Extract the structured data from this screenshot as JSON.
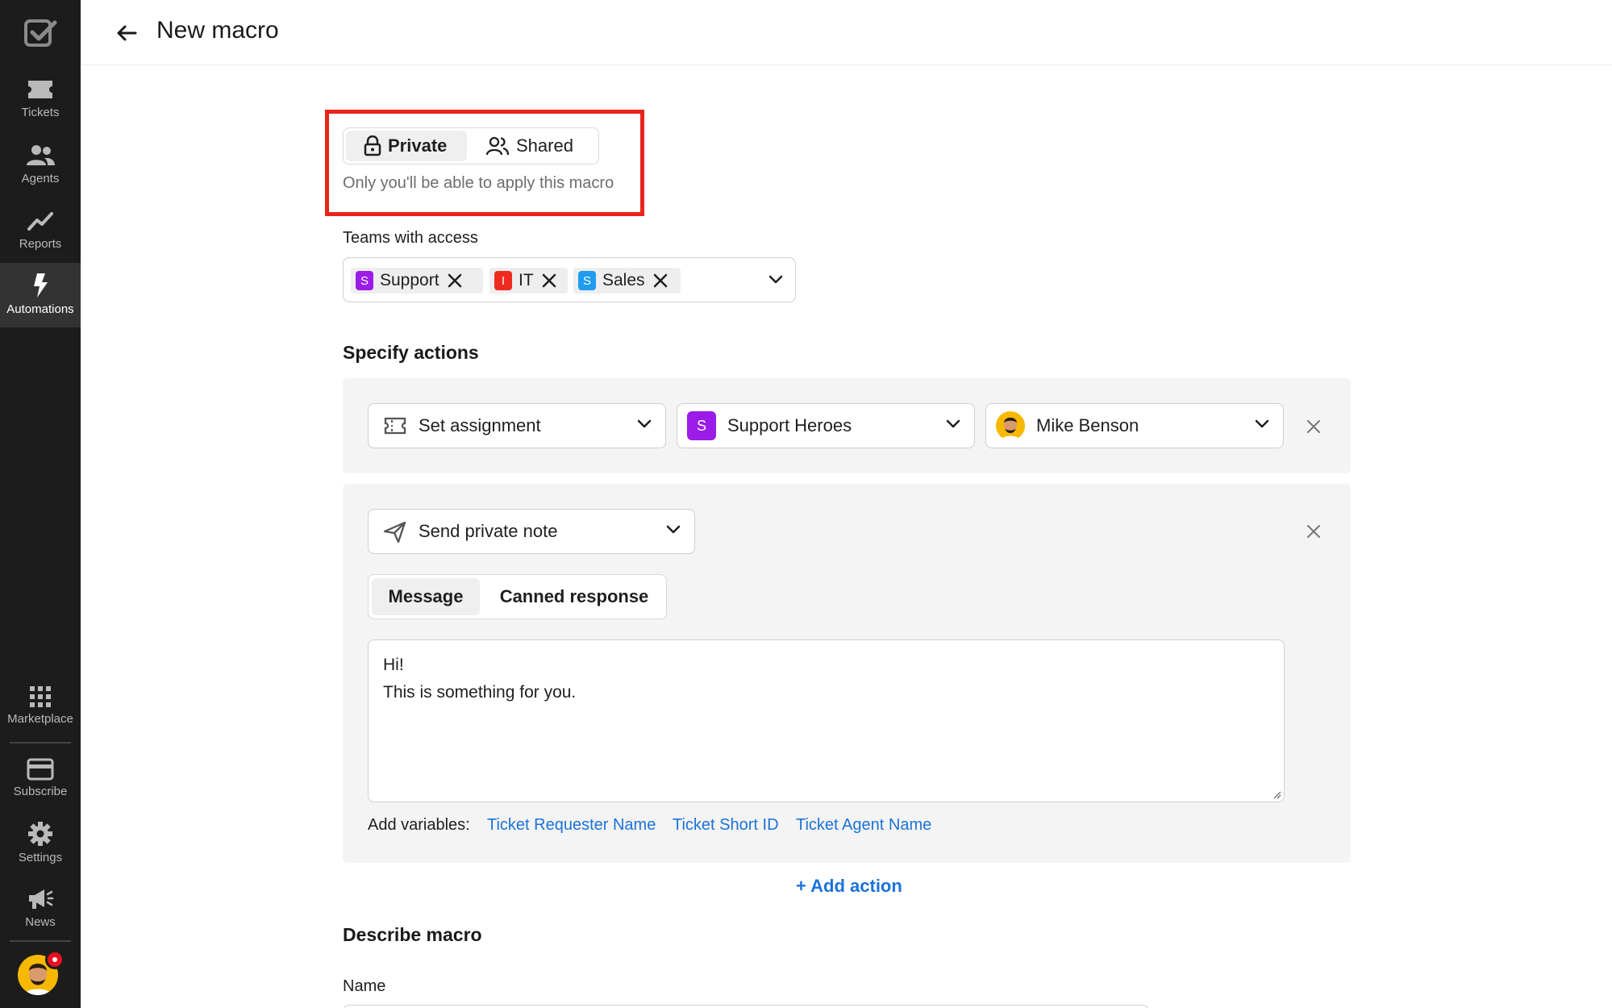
{
  "sidebar": {
    "items": [
      {
        "label": "Tickets",
        "icon": "ticket-icon"
      },
      {
        "label": "Agents",
        "icon": "agents-icon"
      },
      {
        "label": "Reports",
        "icon": "reports-icon"
      },
      {
        "label": "Automations",
        "icon": "lightning-icon",
        "active": true
      },
      {
        "label": "Marketplace",
        "icon": "grid-icon"
      },
      {
        "label": "Subscribe",
        "icon": "card-icon"
      },
      {
        "label": "Settings",
        "icon": "gear-icon"
      },
      {
        "label": "News",
        "icon": "megaphone-icon"
      }
    ]
  },
  "header": {
    "title": "New macro"
  },
  "visibility": {
    "options": [
      "Private",
      "Shared"
    ],
    "selected": "Private",
    "hint": "Only you'll be able to apply this macro"
  },
  "teams": {
    "label": "Teams with access",
    "chips": [
      {
        "letter": "S",
        "name": "Support",
        "color": "#9b1ce8"
      },
      {
        "letter": "I",
        "name": "IT",
        "color": "#ef2b1e"
      },
      {
        "letter": "S",
        "name": "Sales",
        "color": "#1e9cf0"
      }
    ]
  },
  "actions": {
    "title": "Specify actions",
    "assignment": {
      "action": "Set assignment",
      "team_letter": "S",
      "team": "Support Heroes",
      "agent": "Mike Benson"
    },
    "note": {
      "action": "Send private note",
      "tabs": [
        "Message",
        "Canned response"
      ],
      "active_tab": "Message",
      "message": "Hi!\nThis is something for you.",
      "vars_label": "Add variables:",
      "variables": [
        "Ticket Requester Name",
        "Ticket Short ID",
        "Ticket Agent Name"
      ]
    },
    "add_action": "+ Add action"
  },
  "describe": {
    "title": "Describe macro",
    "name_label": "Name"
  },
  "colors": {
    "sidebar_bg": "#1c1c1c",
    "link": "#1a73d9",
    "highlight": "#e8241a"
  }
}
